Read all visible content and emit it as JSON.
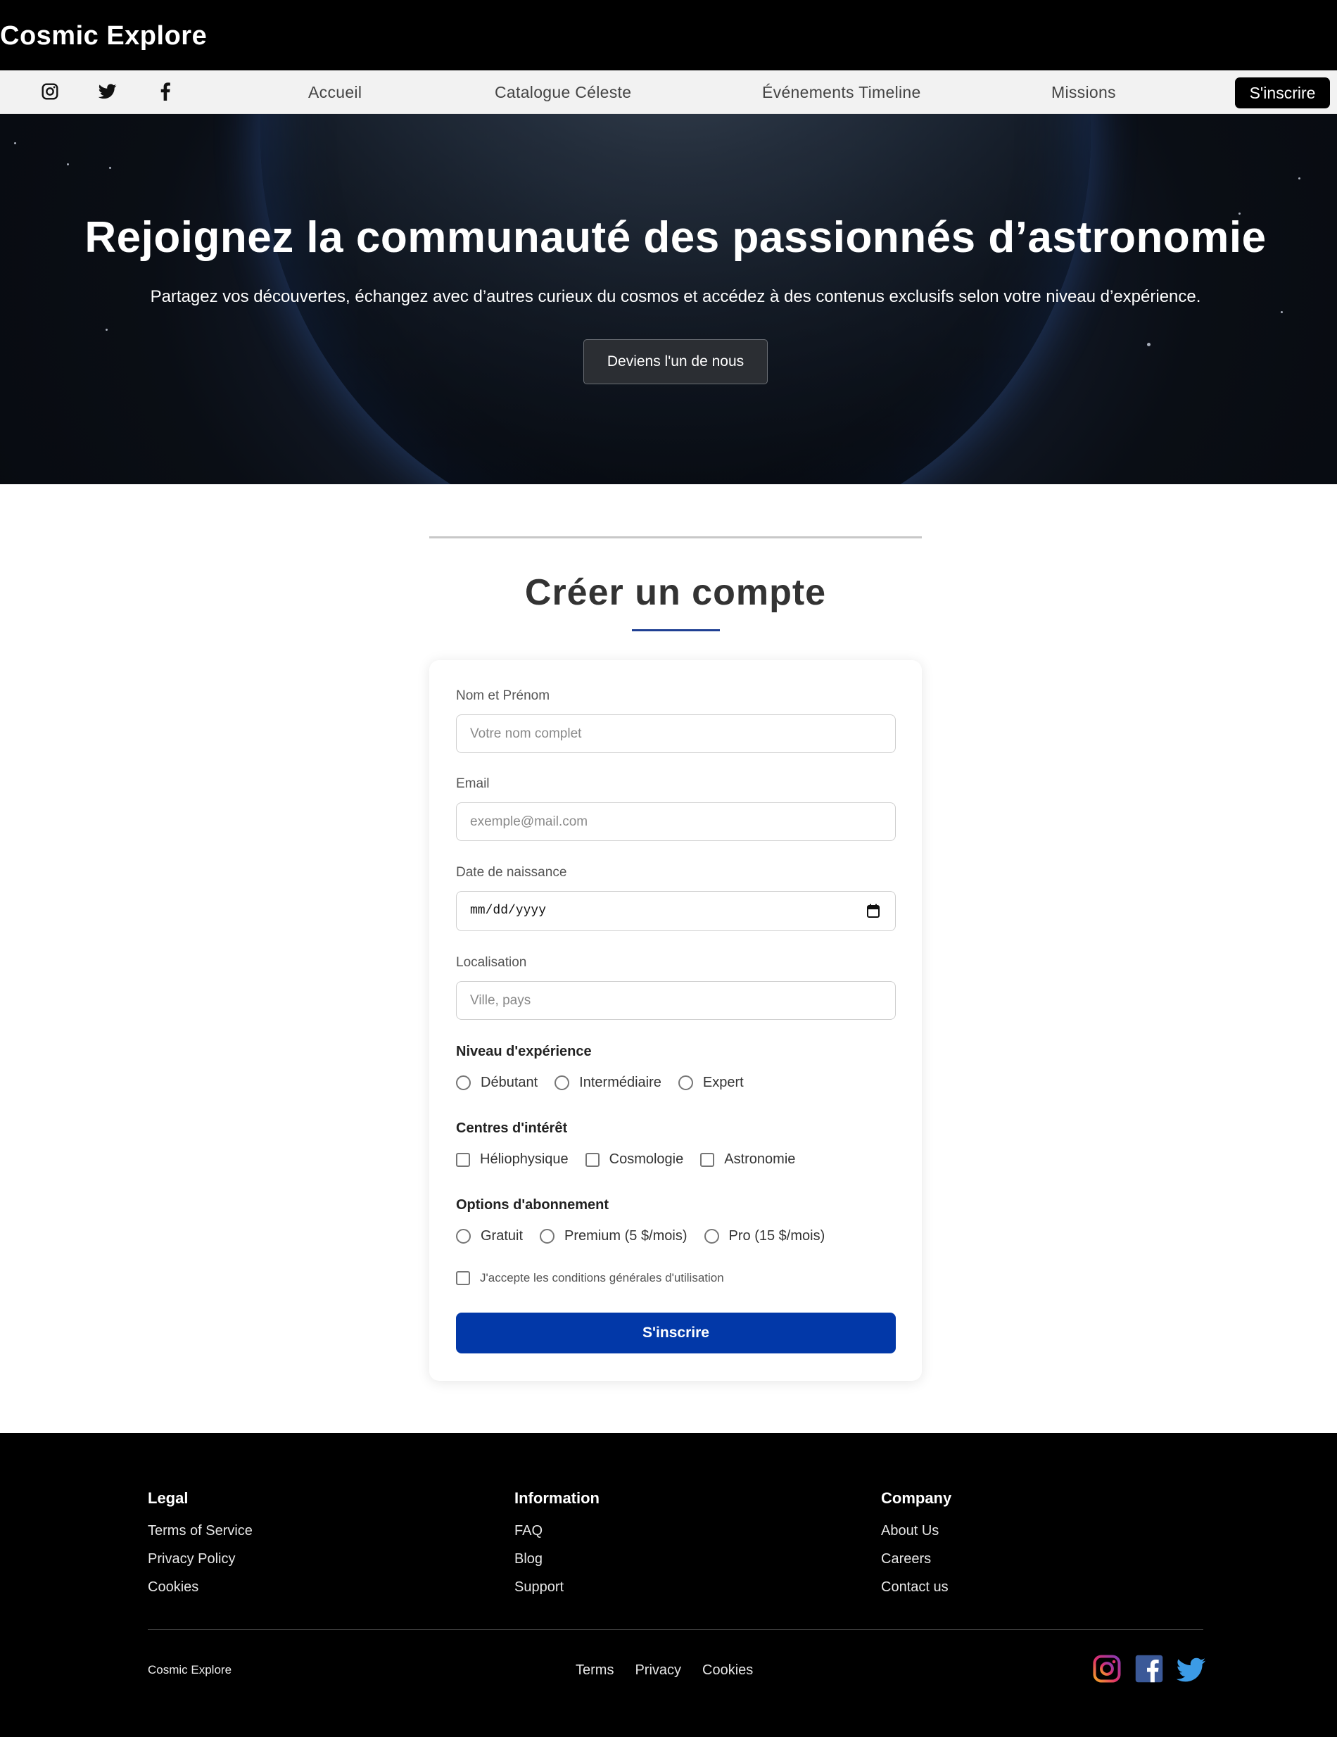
{
  "brand": "Cosmic Explore",
  "nav": {
    "social": [
      "instagram-icon",
      "twitter-icon",
      "facebook-icon"
    ],
    "links": [
      "Accueil",
      "Catalogue Céleste",
      "Événements Timeline",
      "Missions"
    ],
    "signup_label": "S'inscrire"
  },
  "hero": {
    "title": "Rejoignez la communauté des passionnés d’astronomie",
    "subtitle": "Partagez vos découvertes, échangez avec d’autres curieux du cosmos et accédez à des contenus exclusifs selon votre niveau d’expérience.",
    "cta": "Deviens l'un de nous"
  },
  "form": {
    "title": "Créer un compte",
    "name_label": "Nom et Prénom",
    "name_placeholder": "Votre nom complet",
    "email_label": "Email",
    "email_placeholder": "exemple@mail.com",
    "dob_label": "Date de naissance",
    "dob_placeholder": "mm/dd/yyyy",
    "location_label": "Localisation",
    "location_placeholder": "Ville, pays",
    "experience_label": "Niveau d'expérience",
    "experience_options": [
      "Débutant",
      "Intermédiaire",
      "Expert"
    ],
    "interests_label": "Centres d'intérêt",
    "interests_options": [
      "Héliophysique",
      "Cosmologie",
      "Astronomie"
    ],
    "subscription_label": "Options d'abonnement",
    "subscription_options": [
      "Gratuit",
      "Premium (5 $/mois)",
      "Pro (15 $/mois)"
    ],
    "terms_label": "J'accepte les conditions générales d'utilisation",
    "submit_label": "S'inscrire"
  },
  "footer": {
    "columns": [
      {
        "title": "Legal",
        "links": [
          "Terms of Service",
          "Privacy Policy",
          "Cookies"
        ]
      },
      {
        "title": "Information",
        "links": [
          "FAQ",
          "Blog",
          "Support"
        ]
      },
      {
        "title": "Company",
        "links": [
          "About Us",
          "Careers",
          "Contact us"
        ]
      }
    ],
    "brand": "Cosmic Explore",
    "bottom_links": [
      "Terms",
      "Privacy",
      "Cookies"
    ],
    "social": [
      "instagram-icon",
      "facebook-icon",
      "twitter-icon"
    ]
  },
  "colors": {
    "primary": "#0238a8",
    "title_underline": "#1f3f93",
    "header_bg": "#000000",
    "nav_bg": "#f2f2f2",
    "instagram": "#e1306c",
    "facebook": "#3b5998",
    "twitter": "#1da1f2"
  }
}
